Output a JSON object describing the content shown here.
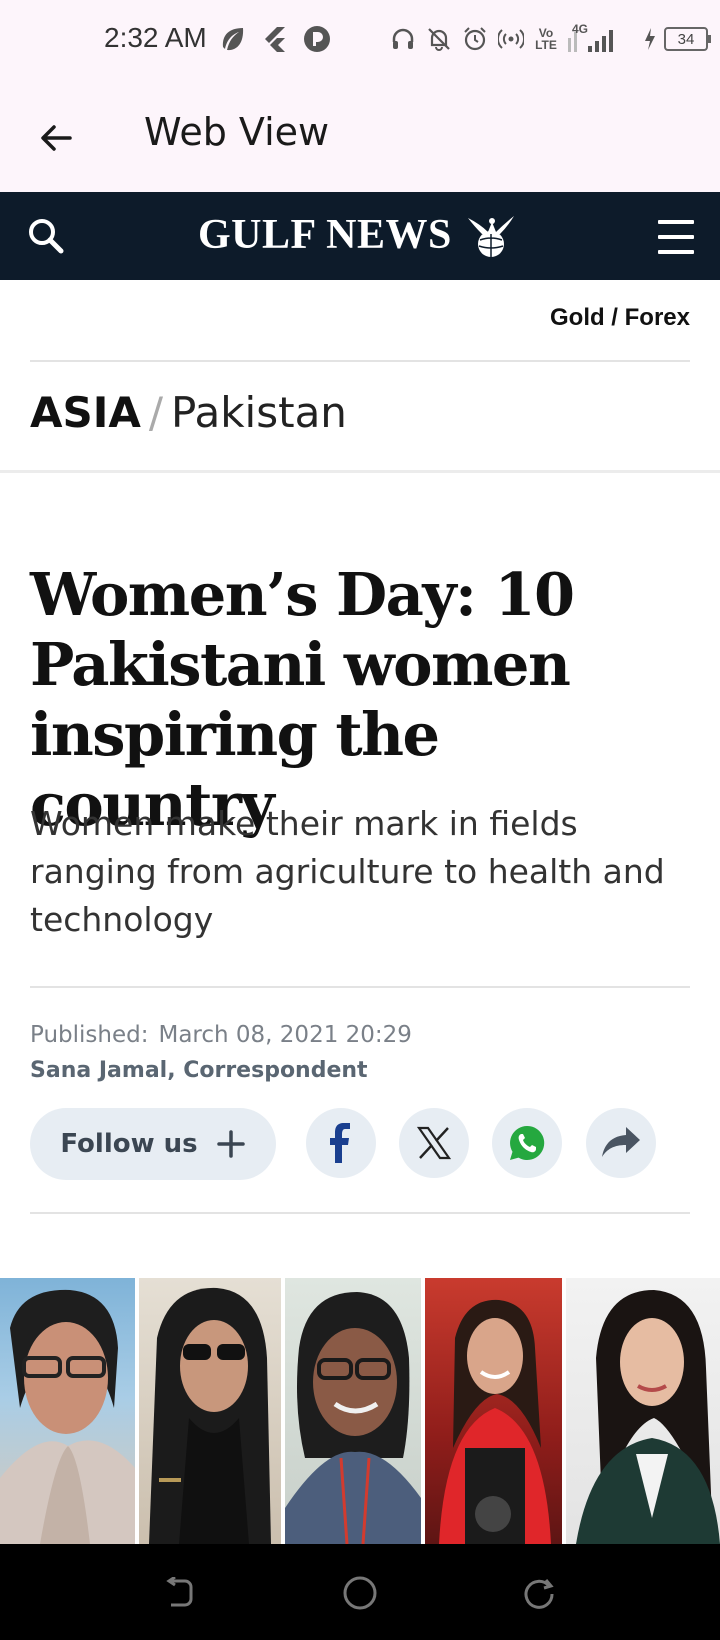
{
  "status_bar": {
    "time": "2:32 AM",
    "battery": "34",
    "network_label": "4G",
    "volte_label": "Vo LTE",
    "left_icons": [
      "leaf-icon",
      "flutter-icon",
      "app-p-icon"
    ],
    "right_icons": [
      "headphones-icon",
      "bell-off-icon",
      "alarm-icon",
      "hotspot-icon",
      "volte-icon",
      "signal-icon",
      "battery-icon"
    ]
  },
  "app_bar": {
    "title": "Web View",
    "back_icon": "arrow-left-icon"
  },
  "site_header": {
    "logo_text": "GULF NEWS",
    "logo_icon": "eagle-globe-icon",
    "search_icon": "search-icon",
    "menu_icon": "hamburger-menu-icon",
    "background": "#0d1b2a"
  },
  "top_link": "Gold / Forex",
  "section": {
    "primary": "ASIA",
    "separator": "/",
    "secondary": "Pakistan"
  },
  "article": {
    "headline": "Women’s Day: 10 Pakistani women inspiring the country",
    "subhead": "Women make their mark in fields ranging from agriculture to health and technology",
    "published_label": "Published:",
    "published_date": "March 08, 2021 20:29",
    "author": "Sana Jamal, Correspondent"
  },
  "share": {
    "follow_label": "Follow us",
    "follow_icon": "plus-icon",
    "buttons": [
      {
        "name": "facebook",
        "icon": "facebook-icon",
        "color": "#1a3f8f"
      },
      {
        "name": "x",
        "icon": "x-twitter-icon",
        "color": "#222222"
      },
      {
        "name": "whatsapp",
        "icon": "whatsapp-icon",
        "color": "#25a83f"
      },
      {
        "name": "share",
        "icon": "share-arrow-icon",
        "color": "#4a5562"
      }
    ]
  },
  "photos": [
    "portrait-1",
    "portrait-2",
    "portrait-3",
    "portrait-4",
    "portrait-5"
  ],
  "nav_bar": {
    "icons": [
      "back-gesture-icon",
      "home-circle-icon",
      "recents-icon"
    ]
  }
}
